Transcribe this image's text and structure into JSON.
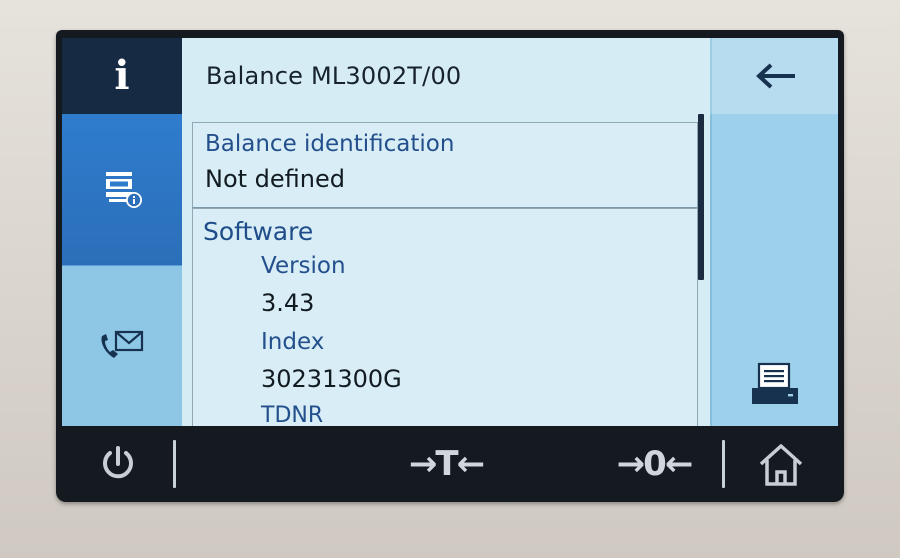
{
  "header": {
    "title": "Balance ML3002T/00"
  },
  "nav": {
    "info_icon": "info-icon",
    "balance_icon": "balance-info-icon",
    "comm_icon": "phone-mail-icon"
  },
  "content": {
    "identification_label": "Balance identification",
    "identification_value": "Not defined",
    "software_heading": "Software",
    "version_label": "Version",
    "version_value": "3.43",
    "index_label": "Index",
    "index_value": "30231300G",
    "next_label_partial": "TDNR"
  },
  "bottom": {
    "power_icon": "power-icon",
    "tare_label": "→T←",
    "zero_label": "→0←",
    "home_icon": "home-icon"
  },
  "colors": {
    "nav_active": "#172a44",
    "nav_blue": "#2d75c4",
    "screen_bg": "#d6ecf4",
    "accent_text": "#23508c"
  }
}
